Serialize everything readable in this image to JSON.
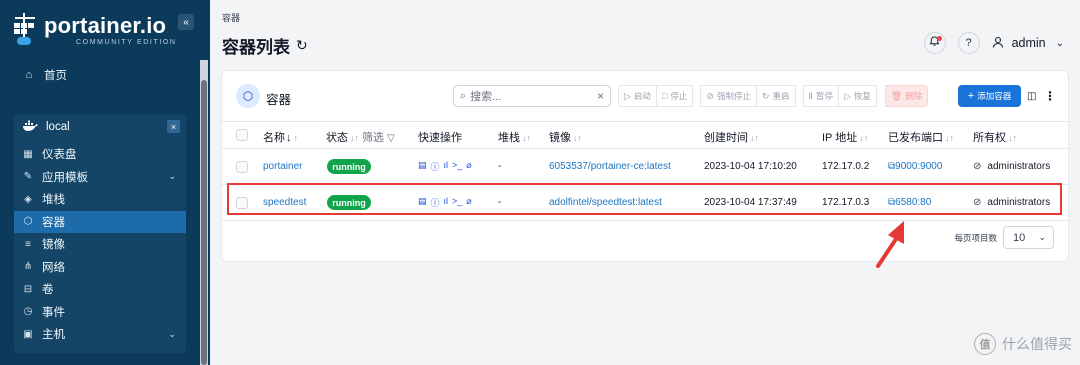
{
  "sidebar": {
    "logo_name": "portainer.io",
    "logo_edition": "COMMUNITY EDITION",
    "collapse_icon": "«",
    "home_label": "首页",
    "environment": {
      "name": "local",
      "close_icon": "×",
      "items": [
        {
          "label": "仪表盘",
          "icon": "dashboard-icon",
          "glyph": "▦"
        },
        {
          "label": "应用模板",
          "icon": "edit-icon",
          "glyph": "✎",
          "chevron": "⌄"
        },
        {
          "label": "堆栈",
          "icon": "layers-icon",
          "glyph": "◈"
        },
        {
          "label": "容器",
          "icon": "box-icon",
          "glyph": "⬡",
          "active": true
        },
        {
          "label": "镜像",
          "icon": "list-icon",
          "glyph": "≡"
        },
        {
          "label": "网络",
          "icon": "network-icon",
          "glyph": "⋔"
        },
        {
          "label": "卷",
          "icon": "database-icon",
          "glyph": "⊟"
        },
        {
          "label": "事件",
          "icon": "clock-icon",
          "glyph": "◷"
        },
        {
          "label": "主机",
          "icon": "host-icon",
          "glyph": "▣",
          "chevron": "⌄"
        }
      ]
    }
  },
  "header": {
    "breadcrumb": "容器",
    "title": "容器列表",
    "refresh_glyph": "↻",
    "username": "admin",
    "bell_glyph": "🔔",
    "help_glyph": "?",
    "user_glyph": "👤",
    "chevron": "⌄"
  },
  "card": {
    "title": "容器",
    "search_placeholder": "搜索...",
    "search_clear": "×",
    "actions": [
      {
        "label": "启动",
        "glyph": "▷"
      },
      {
        "label": "停止",
        "glyph": "□"
      },
      {
        "label": "强制停止",
        "glyph": "⊘"
      },
      {
        "label": "重启",
        "glyph": "↻"
      },
      {
        "label": "暂停",
        "glyph": "Ⅱ"
      },
      {
        "label": "恢复",
        "glyph": "▷"
      },
      {
        "label": "删除",
        "glyph": "🗑"
      }
    ],
    "add_label": "添加容器",
    "add_glyph": "+"
  },
  "table": {
    "columns": {
      "name": "名称",
      "state": "状态",
      "filter": "筛选",
      "quick_actions": "快速操作",
      "stack": "堆栈",
      "image": "镜像",
      "created": "创建时间",
      "ip": "IP 地址",
      "ports": "已发布端口",
      "ownership": "所有权"
    },
    "sort_glyph": "↓↑",
    "quick_glyphs": [
      "▤",
      "ⓘ",
      "ıl",
      ">_",
      "⌀"
    ],
    "rows": [
      {
        "name": "portainer",
        "state": "running",
        "stack": "-",
        "image": "6053537/portainer-ce:latest",
        "created": "2023-10-04 17:10:20",
        "ip": "172.17.0.2",
        "ports": "9000:9000",
        "ownership": "administrators"
      },
      {
        "name": "speedtest",
        "state": "running",
        "stack": "-",
        "image": "adolfintel/speedtest:latest",
        "created": "2023-10-04 17:37:49",
        "ip": "172.17.0.3",
        "ports": "6580:80",
        "ownership": "administrators"
      }
    ]
  },
  "pagination": {
    "label": "每页项目数",
    "value": "10"
  },
  "watermark": {
    "logo": "值",
    "text": "什么值得买"
  },
  "colors": {
    "sidebar_bg": "#0c3a5b",
    "accent": "#1a73d9",
    "running": "#11a54b",
    "highlight": "#e53935"
  }
}
